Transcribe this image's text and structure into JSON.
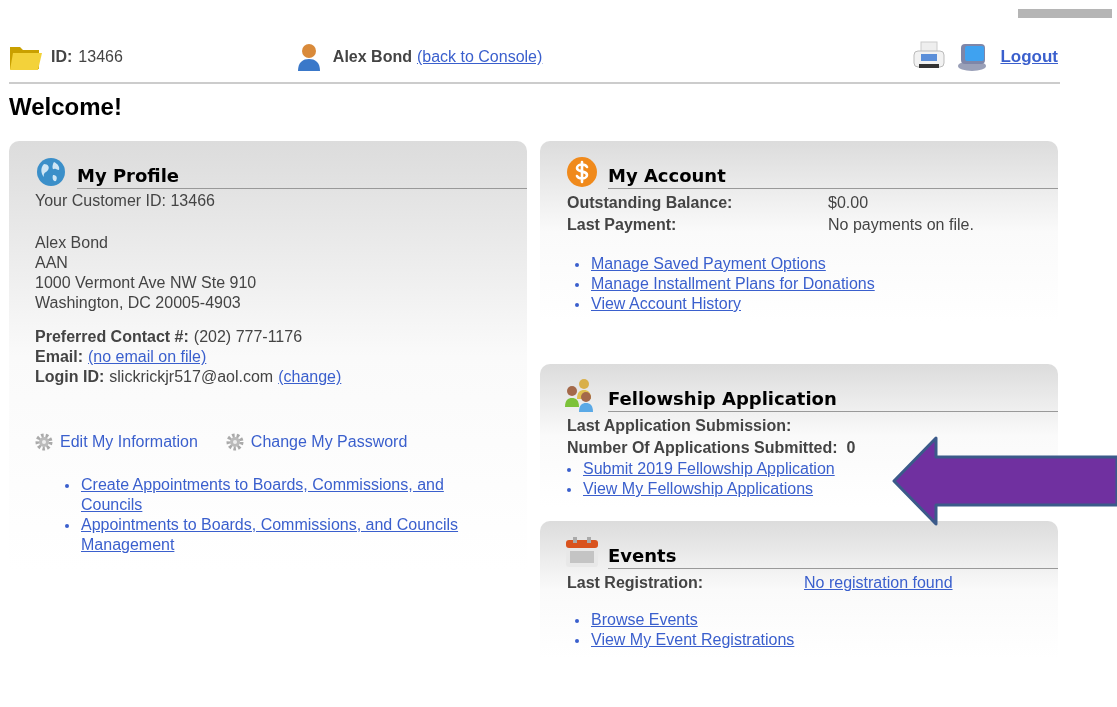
{
  "header": {
    "id_label": "ID:",
    "id_value": "13466",
    "user_name": "Alex Bond",
    "console_link": "(back to Console)",
    "logout": "Logout"
  },
  "title": "Welcome!",
  "profile": {
    "title": "My Profile",
    "customer_id": "Your Customer ID: 13466",
    "address": [
      "Alex Bond",
      "AAN",
      "1000 Vermont Ave NW Ste 910",
      "Washington, DC 20005-4903"
    ],
    "contact": [
      {
        "label": "Preferred Contact #:",
        "value": "(202) 777-1176",
        "kind": "text"
      },
      {
        "label": "Email:",
        "value": "(no email on file)",
        "kind": "link"
      },
      {
        "label": "Login ID:",
        "value": "slickrickjr517@aol.com",
        "link": "(change)",
        "kind": "text_link"
      }
    ],
    "actions": [
      "Edit My Information",
      "Change My Password"
    ],
    "links": [
      "Create Appointments to Boards, Commissions, and Councils",
      "Appointments to Boards, Commissions, and Councils Management"
    ]
  },
  "account": {
    "title": "My Account",
    "fields": [
      {
        "label": "Outstanding Balance:",
        "value": "$0.00"
      },
      {
        "label": "Last Payment:",
        "value": "No payments on file."
      }
    ],
    "links": [
      "Manage Saved Payment Options",
      "Manage Installment Plans for Donations",
      "View Account History"
    ]
  },
  "fellowship": {
    "title": "Fellowship Application",
    "fields": [
      {
        "label": "Last Application Submission:"
      },
      {
        "label": "Number Of Applications Submitted:",
        "value": "0"
      }
    ],
    "links": [
      "Submit 2019 Fellowship Application",
      "View My Fellowship Applications"
    ]
  },
  "events": {
    "title": "Events",
    "field": {
      "label": "Last Registration:",
      "value": "No registration found"
    },
    "links": [
      "Browse Events",
      "View My Event Registrations"
    ]
  }
}
